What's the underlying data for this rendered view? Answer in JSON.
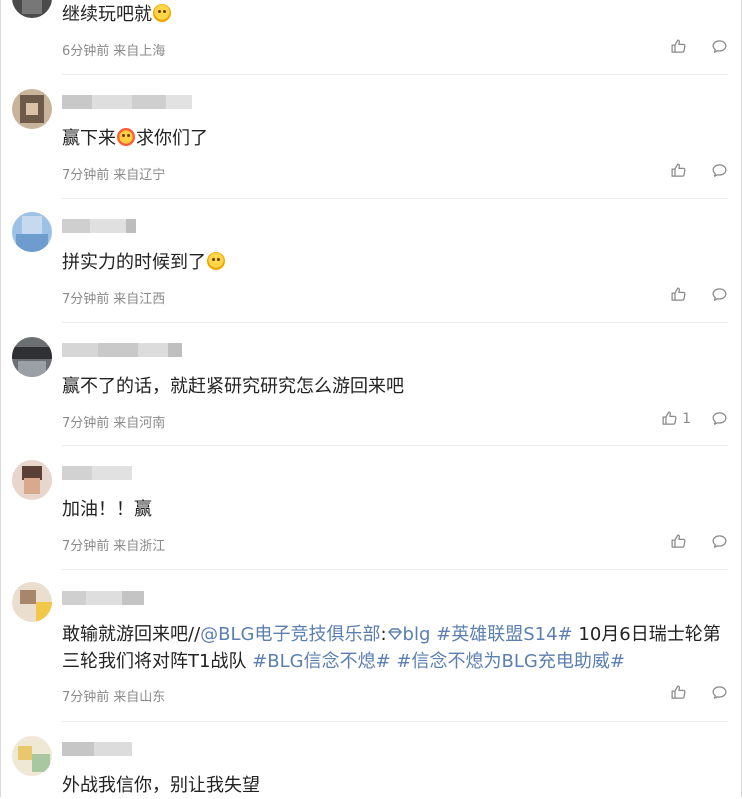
{
  "comments": [
    {
      "text": "继续玩吧就",
      "emoji_after": "smile-emoji",
      "time": "6分钟前",
      "location": "来自上海",
      "likes": ""
    },
    {
      "text_a": "赢下来",
      "emoji_mid": "pray-emoji",
      "text_b": "求你们了",
      "time": "7分钟前",
      "location": "来自辽宁",
      "likes": ""
    },
    {
      "text": "拼实力的时候到了",
      "emoji_after": "cheer-emoji",
      "time": "7分钟前",
      "location": "来自江西",
      "likes": ""
    },
    {
      "text": "赢不了的话，就赶紧研究研究怎么游回来吧",
      "time": "7分钟前",
      "location": "来自河南",
      "likes": "1"
    },
    {
      "text": "加油！！赢",
      "time": "7分钟前",
      "location": "来自浙江",
      "likes": ""
    },
    {
      "text_prefix": "敢输就游回来吧//",
      "mention": "@BLG电子竞技俱乐部",
      "colon": ":",
      "tag_blg": "blg",
      "hashtag1": "#英雄联盟S14#",
      "text_mid": " 10月6日瑞士轮第三轮我们将对阵T1战队 ",
      "hashtag2": "#BLG信念不熄#",
      "hashtag3": "#信念不熄为BLG充电助威#",
      "time": "7分钟前",
      "location": "来自山东",
      "likes": ""
    },
    {
      "text": "外战我信你，别让我失望"
    }
  ],
  "colors": {
    "link": "#5b7fb0",
    "meta": "#8a8a8a",
    "text": "#222222",
    "divider": "#ececec"
  }
}
